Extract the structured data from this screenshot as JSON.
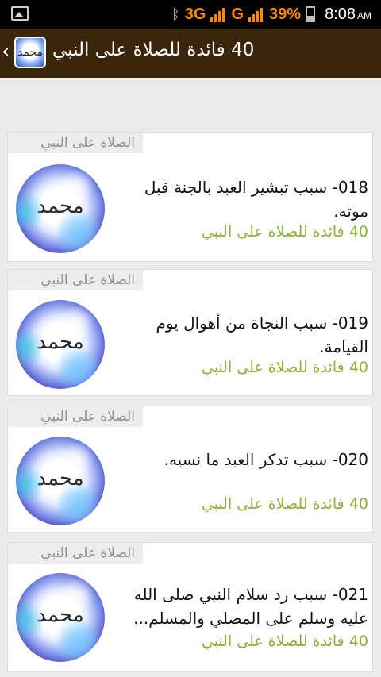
{
  "status_bar": {
    "network_3g": "3G",
    "network_g": "G",
    "battery": "39%",
    "time": "8:08",
    "ampm": "AM"
  },
  "action_bar": {
    "back_glyph": "‹",
    "logo_text": "محمد",
    "title": "40 فائدة للصلاة على النبي"
  },
  "items": [
    {
      "header": "الصلاة على النبي",
      "title_lines": [
        "018- سبب تبشير العبد بالجنة قبل",
        "موته."
      ],
      "subtitle": "40 فائدة للصلاة على النبي",
      "thumb_text": "محمد"
    },
    {
      "header": "الصلاة على النبي",
      "title_lines": [
        "019- سبب النجاة من أهوال يوم",
        "القيامة."
      ],
      "subtitle": "40 فائدة للصلاة على النبي",
      "thumb_text": "محمد"
    },
    {
      "header": "الصلاة على النبي",
      "title_lines": [
        "020- سبب تذكر العبد ما نسيه.",
        ""
      ],
      "subtitle": "40 فائدة للصلاة على النبي",
      "thumb_text": "محمد"
    },
    {
      "header": "الصلاة على النبي",
      "title_lines": [
        "021- سبب رد سلام النبي صلى الله",
        "عليه وسلم على المصلي والمسلم..."
      ],
      "subtitle": "40 فائدة للصلاة على النبي",
      "thumb_text": "محمد"
    }
  ]
}
